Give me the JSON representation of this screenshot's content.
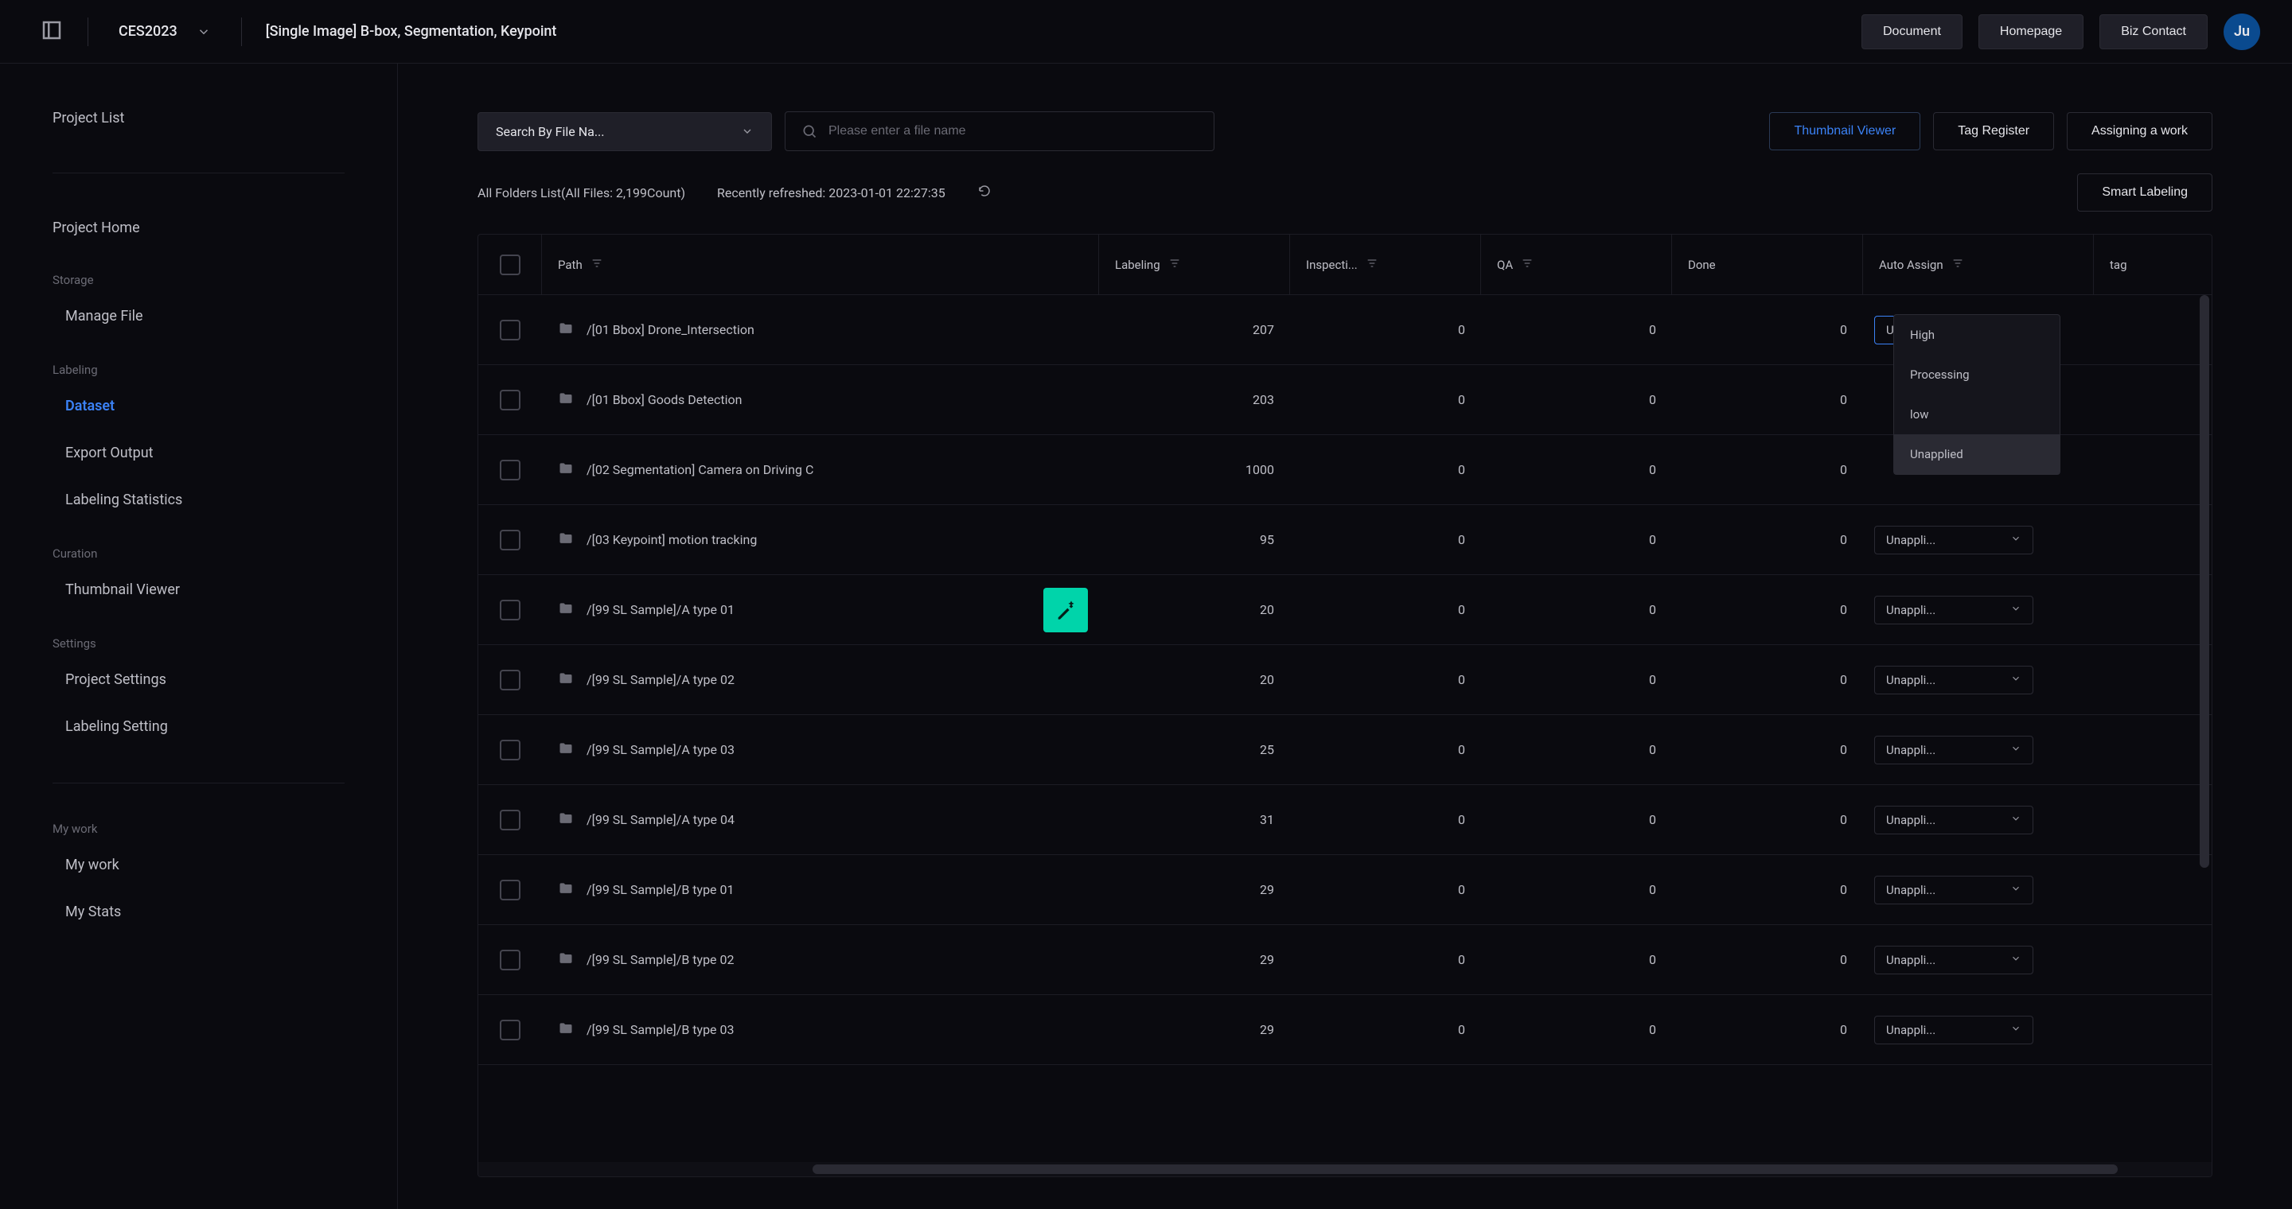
{
  "topbar": {
    "project_select": "CES2023",
    "page_title": "[Single Image] B-box, Segmentation, Keypoint",
    "nav": {
      "document": "Document",
      "homepage": "Homepage",
      "contact": "Biz Contact"
    },
    "avatar": "Ju"
  },
  "sidebar": {
    "project_list": "Project List",
    "project_home": "Project Home",
    "groups": [
      {
        "label": "Storage",
        "items": [
          "Manage File"
        ]
      },
      {
        "label": "Labeling",
        "items": [
          "Dataset",
          "Export Output",
          "Labeling Statistics"
        ],
        "active": "Dataset"
      },
      {
        "label": "Curation",
        "items": [
          "Thumbnail Viewer"
        ]
      },
      {
        "label": "Settings",
        "items": [
          "Project Settings",
          "Labeling Setting"
        ]
      }
    ],
    "mywork": {
      "label": "My work",
      "items": [
        "My work",
        "My Stats"
      ]
    }
  },
  "toolbar": {
    "search_mode": "Search By File Na...",
    "search_placeholder": "Please enter a file name",
    "thumbnail_viewer": "Thumbnail Viewer",
    "tag_register": "Tag Register",
    "assigning": "Assigning a work"
  },
  "status": {
    "count_text": "All Folders List(All Files: 2,199Count)",
    "refreshed": "Recently refreshed: 2023-01-01 22:27:35",
    "smart": "Smart Labeling"
  },
  "columns": {
    "path": "Path",
    "labeling": "Labeling",
    "inspection": "Inspecti...",
    "qa": "QA",
    "done": "Done",
    "auto_assign": "Auto Assign",
    "tag": "tag"
  },
  "auto_assign_options": [
    "High",
    "Processing",
    "low",
    "Unapplied"
  ],
  "auto_assign_open_row": 0,
  "rows": [
    {
      "path": "/[01 Bbox] Drone_Intersection",
      "labeling": 207,
      "inspection": 0,
      "qa": 0,
      "done": 0,
      "assign": "Unappli...",
      "action": false
    },
    {
      "path": "/[01 Bbox] Goods Detection",
      "labeling": 203,
      "inspection": 0,
      "qa": 0,
      "done": 0,
      "assign": "",
      "action": false
    },
    {
      "path": "/[02 Segmentation] Camera on Driving C",
      "labeling": 1000,
      "inspection": 0,
      "qa": 0,
      "done": 0,
      "assign": "",
      "action": false
    },
    {
      "path": "/[03 Keypoint] motion tracking",
      "labeling": 95,
      "inspection": 0,
      "qa": 0,
      "done": 0,
      "assign": "Unappli...",
      "action": false
    },
    {
      "path": "/[99 SL Sample]/A type 01",
      "labeling": 20,
      "inspection": 0,
      "qa": 0,
      "done": 0,
      "assign": "Unappli...",
      "action": true
    },
    {
      "path": "/[99 SL Sample]/A type 02",
      "labeling": 20,
      "inspection": 0,
      "qa": 0,
      "done": 0,
      "assign": "Unappli...",
      "action": false
    },
    {
      "path": "/[99 SL Sample]/A type 03",
      "labeling": 25,
      "inspection": 0,
      "qa": 0,
      "done": 0,
      "assign": "Unappli...",
      "action": false
    },
    {
      "path": "/[99 SL Sample]/A type 04",
      "labeling": 31,
      "inspection": 0,
      "qa": 0,
      "done": 0,
      "assign": "Unappli...",
      "action": false
    },
    {
      "path": "/[99 SL Sample]/B type 01",
      "labeling": 29,
      "inspection": 0,
      "qa": 0,
      "done": 0,
      "assign": "Unappli...",
      "action": false
    },
    {
      "path": "/[99 SL Sample]/B type 02",
      "labeling": 29,
      "inspection": 0,
      "qa": 0,
      "done": 0,
      "assign": "Unappli...",
      "action": false
    },
    {
      "path": "/[99 SL Sample]/B type 03",
      "labeling": 29,
      "inspection": 0,
      "qa": 0,
      "done": 0,
      "assign": "Unappli...",
      "action": false
    }
  ]
}
